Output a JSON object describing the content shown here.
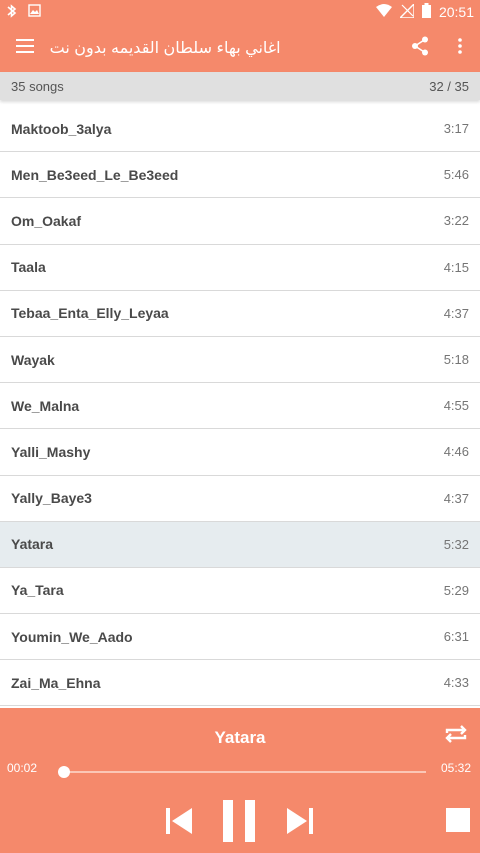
{
  "status": {
    "time": "20:51",
    "icons": [
      "bluetooth-icon",
      "image-icon",
      "wifi-icon",
      "signal-icon",
      "battery-icon"
    ]
  },
  "app": {
    "title": "اغاني بهاء سلطان القديمه بدون نت",
    "accent_color": "#f5896b"
  },
  "summary": {
    "count_text": "35 songs",
    "position_text": "32 / 35"
  },
  "songs": [
    {
      "name": "Maktoob_3alya",
      "duration": "3:17"
    },
    {
      "name": "Men_Be3eed_Le_Be3eed",
      "duration": "5:46"
    },
    {
      "name": "Om_Oakaf",
      "duration": "3:22"
    },
    {
      "name": "Taala",
      "duration": "4:15"
    },
    {
      "name": "Tebaa_Enta_Elly_Leyaa",
      "duration": "4:37"
    },
    {
      "name": "Wayak",
      "duration": "5:18"
    },
    {
      "name": "We_Malna",
      "duration": "4:55"
    },
    {
      "name": "Yalli_Mashy",
      "duration": "4:46"
    },
    {
      "name": "Yally_Baye3",
      "duration": "4:37"
    },
    {
      "name": "Yatara",
      "duration": "5:32"
    },
    {
      "name": "Ya_Tara",
      "duration": "5:29"
    },
    {
      "name": "Youmin_We_Aado",
      "duration": "6:31"
    },
    {
      "name": "Zai_Ma_Ehna",
      "duration": "4:33"
    }
  ],
  "player": {
    "now_playing": "Yatara",
    "elapsed": "00:02",
    "total": "05:32",
    "progress_fraction": 0.006
  }
}
